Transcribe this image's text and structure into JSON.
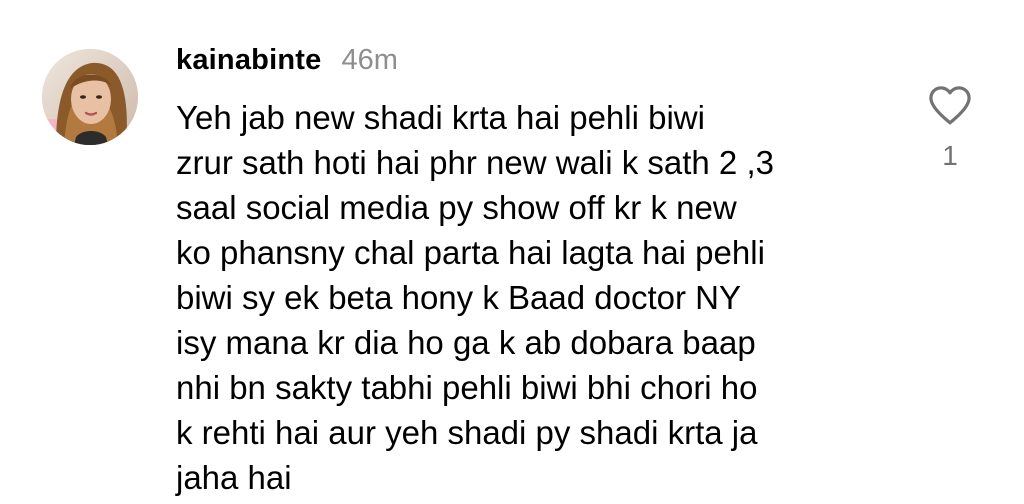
{
  "comment": {
    "username": "kainabinte",
    "time": "46m",
    "text_lines": [
      "Yeh jab new shadi krta hai pehli biwi",
      "zrur sath hoti hai phr new wali k sath 2 ,3",
      "saal social media py show off kr k new",
      "ko phansny chal parta hai lagta hai pehli",
      "biwi sy ek beta hony k Baad doctor NY",
      "isy mana kr dia ho ga k ab dobara baap",
      "nhi bn sakty tabhi pehli biwi bhi chori ho",
      "k rehti hai aur yeh shadi py shadi krta ja",
      "jaha hai"
    ],
    "like_count": "1",
    "like_icon": "heart-outline-icon",
    "avatar": "profile-photo"
  },
  "colors": {
    "text": "#000000",
    "muted": "#8e8e8e",
    "like_count": "#737373"
  }
}
